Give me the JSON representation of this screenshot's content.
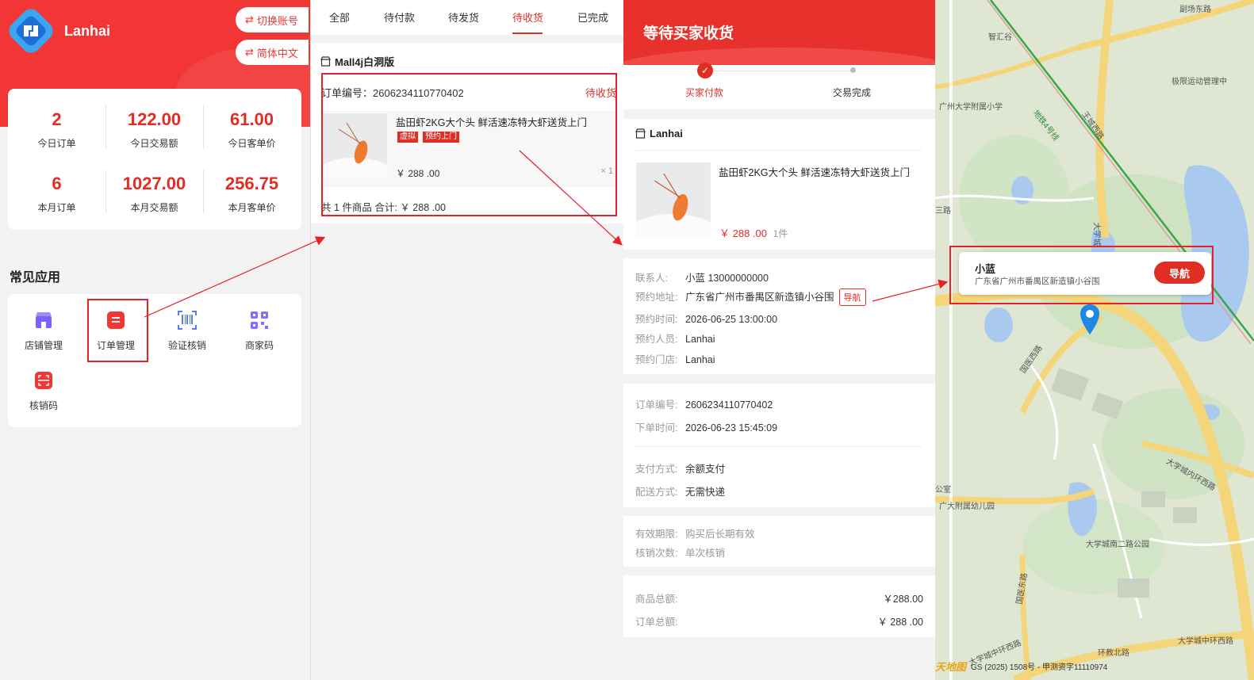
{
  "colors": {
    "brand_red": "#e02e24",
    "header_red": "#f23535",
    "map_bg": "#dde6d0",
    "road_yellow": "#f7d87a",
    "lake_blue": "#a9c9ee"
  },
  "dashboard": {
    "brand": "Lanhai",
    "switch_account": "切换账号",
    "language": "简体中文",
    "stats": [
      {
        "value": "2",
        "label": "今日订单"
      },
      {
        "value": "122.00",
        "label": "今日交易额"
      },
      {
        "value": "61.00",
        "label": "今日客单价"
      },
      {
        "value": "6",
        "label": "本月订单"
      },
      {
        "value": "1027.00",
        "label": "本月交易额"
      },
      {
        "value": "256.75",
        "label": "本月客单价"
      }
    ],
    "common_apps_title": "常见应用",
    "apps": [
      {
        "label": "店铺管理",
        "icon": "shop-icon",
        "color": "#7b61ff"
      },
      {
        "label": "订单管理",
        "icon": "order-icon",
        "color": "#f23535"
      },
      {
        "label": "验证核销",
        "icon": "barcode-scan-icon",
        "color": "#5b7bff"
      },
      {
        "label": "商家码",
        "icon": "qrcode-icon",
        "color": "#8a6cff"
      },
      {
        "label": "核销码",
        "icon": "scan-frame-icon",
        "color": "#f23535"
      }
    ]
  },
  "order_list": {
    "tabs": [
      "全部",
      "待付款",
      "待发货",
      "待收货",
      "已完成"
    ],
    "active_tab": "待收货",
    "shop_name": "Mall4j白洞版",
    "order_no": "订单编号：2606234110770402",
    "status": "待收货",
    "product_title": "盐田虾2KG大个头 鲜活速冻特大虾送货上门",
    "tags": [
      "虚拟",
      "预约上门"
    ],
    "price": "￥ 288 .00",
    "qty": "× 1",
    "summary": "共 1 件商品   合计:   ￥ 288 .00"
  },
  "order_detail": {
    "title": "等待买家收货",
    "steps": [
      "买家付款",
      "交易完成"
    ],
    "shop_name": "Lanhai",
    "product_title": "盐田虾2KG大个头 鲜活速冻特大虾送货上门",
    "price": "￥ 288 .00",
    "qty": "1件",
    "contact_label": "联系人:",
    "contact_value": "小蓝 13000000000",
    "address_label": "预约地址:",
    "address_value": "广东省广州市番禺区新造镇小谷围",
    "nav_button": "导航",
    "time_label": "预约时间:",
    "time_value": "2026-06-25 13:00:00",
    "person_label": "预约人员:",
    "person_value": "Lanhai",
    "store_label": "预约门店:",
    "store_value": "Lanhai",
    "order_no_label": "订单编号:",
    "order_no_value": "2606234110770402",
    "order_time_label": "下单时间:",
    "order_time_value": "2026-06-23 15:45:09",
    "pay_label": "支付方式:",
    "pay_value": "余额支付",
    "delivery_label": "配送方式:",
    "delivery_value": "无需快递",
    "validity_label": "有效期限:",
    "validity_value": "购买后长期有效",
    "verify_label": "核销次数:",
    "verify_value": "单次核销",
    "goods_total_label": "商品总额:",
    "goods_total_value": "￥288.00",
    "order_total_label": "订单总额:",
    "order_total_value": "￥ 288 .00"
  },
  "map": {
    "popup_name": "小蓝",
    "popup_address": "广东省广州市番禺区新造镇小谷围",
    "popup_button": "导航",
    "labels": [
      "智汇谷",
      "副场东路",
      "极限运动管理中",
      "广州大学附属小学",
      "地铁4号线",
      "王城西路",
      "三路",
      "大学城",
      "国医西路",
      "大学城内环西路",
      "公室",
      "广大附属幼儿园",
      "大学城南二路公园",
      "国医东路",
      "大学城中环西路",
      "环教北路",
      "大学城中环西路"
    ],
    "attribution": "GS (2025) 1508号 - 甲测资字11110974",
    "provider": "天地图"
  }
}
